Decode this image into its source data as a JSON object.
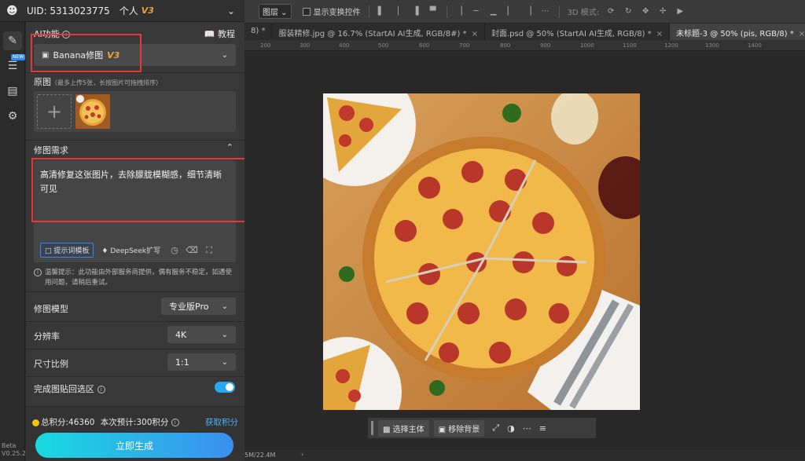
{
  "header": {
    "uid": "UID: 5313023775",
    "plan": "个人",
    "plan_badge": "V3"
  },
  "rail": {
    "new_badge": "NEW",
    "version_beta": "Beta",
    "version": "V0.25.2"
  },
  "ai_function": {
    "title": "AI功能",
    "tutorial": "教程",
    "selected": "Banana修图",
    "badge": "V3"
  },
  "source": {
    "title": "原图",
    "hint": "（最多上传5张，长按图片可拖拽排序）"
  },
  "request": {
    "title": "修图需求",
    "text": "高清修复这张图片，去除朦胧模糊感，细节清晰可见",
    "template_btn": "提示词模板",
    "deepseek_btn": "DeepSeek扩写"
  },
  "notice": "温馨提示：此功能由外部服务商提供，偶有服务不稳定，如遇使用问题，请稍后重试。",
  "model": {
    "label": "修图模型",
    "value": "专业版Pro"
  },
  "resolution": {
    "label": "分辨率",
    "value": "4K"
  },
  "ratio": {
    "label": "尺寸比例",
    "value": "1:1"
  },
  "paste_back": {
    "label": "完成图贴回选区",
    "enabled": true
  },
  "footer": {
    "points": "总积分:46360",
    "estimate": "本次预计:300积分",
    "get_points": "获取积分",
    "generate": "立即生成"
  },
  "ps_toolbar": {
    "layer_combo": "图层",
    "show_transform": "显示变换控件",
    "mode_3d": "3D 模式:"
  },
  "tabs": [
    {
      "label": "8) *"
    },
    {
      "label": "服装精修.jpg @ 16.7% (StartAI AI生成, RGB/8#) *"
    },
    {
      "label": "封面.psd @ 50% (StartAI AI生成, RGB/8) *"
    },
    {
      "label": "未标题-3 @ 50% (pis, RGB/8) *",
      "active": true
    }
  ],
  "ruler": [
    "200",
    "300",
    "400",
    "500",
    "600",
    "700",
    "800",
    "900",
    "1000",
    "1100",
    "1200",
    "1300",
    "1400"
  ],
  "context_bar": {
    "select_subject": "选择主体",
    "remove_bg": "移除背景"
  },
  "status": {
    "doc_size": "5M/22.4M"
  }
}
